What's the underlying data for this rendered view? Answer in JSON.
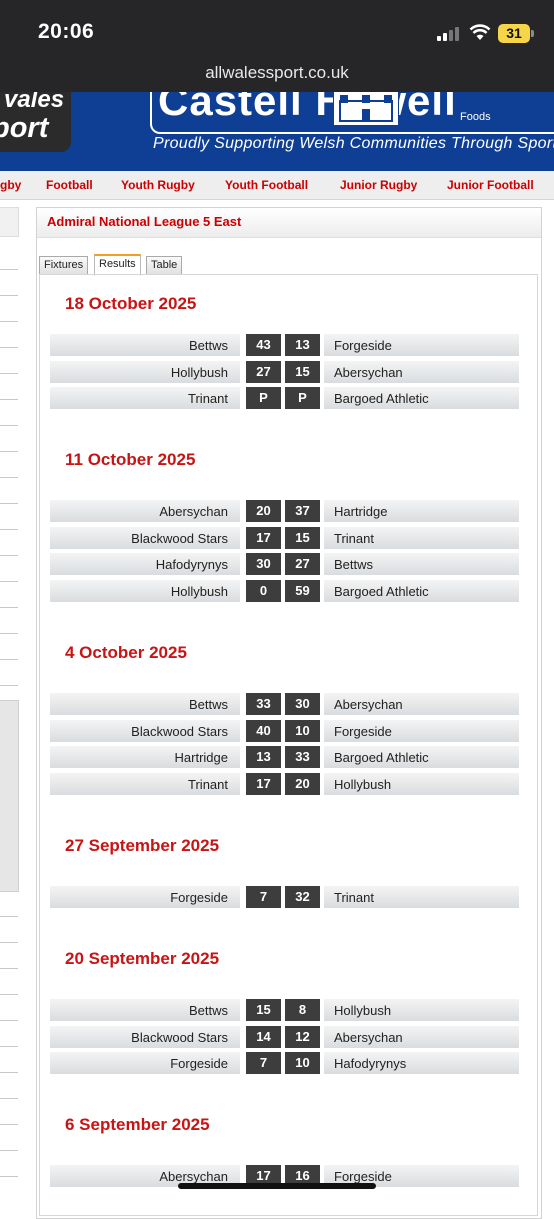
{
  "status_bar": {
    "time": "20:06",
    "battery": "31"
  },
  "browser": {
    "url": "allwalessport.co.uk"
  },
  "header": {
    "logo_line1": "vales",
    "logo_line2": "port",
    "sponsor_name": "Castell Howell",
    "sponsor_sub": "Foods",
    "sponsor_tagline": "Proudly Supporting Welsh Communities Through Sport"
  },
  "nav": {
    "items": [
      "gby",
      "Football",
      "Youth Rugby",
      "Youth Football",
      "Junior Rugby",
      "Junior Football"
    ]
  },
  "panel": {
    "title": "Admiral National League 5 East",
    "tabs": [
      "Fixtures",
      "Results",
      "Table"
    ],
    "active_tab": "Results"
  },
  "results": [
    {
      "date": "18 October 2025",
      "matches": [
        {
          "home": "Bettws",
          "home_score": "43",
          "away_score": "13",
          "away": "Forgeside"
        },
        {
          "home": "Hollybush",
          "home_score": "27",
          "away_score": "15",
          "away": "Abersychan"
        },
        {
          "home": "Trinant",
          "home_score": "P",
          "away_score": "P",
          "away": "Bargoed Athletic"
        }
      ]
    },
    {
      "date": "11 October 2025",
      "matches": [
        {
          "home": "Abersychan",
          "home_score": "20",
          "away_score": "37",
          "away": "Hartridge"
        },
        {
          "home": "Blackwood Stars",
          "home_score": "17",
          "away_score": "15",
          "away": "Trinant"
        },
        {
          "home": "Hafodyrynys",
          "home_score": "30",
          "away_score": "27",
          "away": "Bettws"
        },
        {
          "home": "Hollybush",
          "home_score": "0",
          "away_score": "59",
          "away": "Bargoed Athletic"
        }
      ]
    },
    {
      "date": "4 October 2025",
      "matches": [
        {
          "home": "Bettws",
          "home_score": "33",
          "away_score": "30",
          "away": "Abersychan"
        },
        {
          "home": "Blackwood Stars",
          "home_score": "40",
          "away_score": "10",
          "away": "Forgeside"
        },
        {
          "home": "Hartridge",
          "home_score": "13",
          "away_score": "33",
          "away": "Bargoed Athletic"
        },
        {
          "home": "Trinant",
          "home_score": "17",
          "away_score": "20",
          "away": "Hollybush"
        }
      ]
    },
    {
      "date": "27 September 2025",
      "matches": [
        {
          "home": "Forgeside",
          "home_score": "7",
          "away_score": "32",
          "away": "Trinant"
        }
      ]
    },
    {
      "date": "20 September 2025",
      "matches": [
        {
          "home": "Bettws",
          "home_score": "15",
          "away_score": "8",
          "away": "Hollybush"
        },
        {
          "home": "Blackwood Stars",
          "home_score": "14",
          "away_score": "12",
          "away": "Abersychan"
        },
        {
          "home": "Forgeside",
          "home_score": "7",
          "away_score": "10",
          "away": "Hafodyrynys"
        }
      ]
    },
    {
      "date": "6 September 2025",
      "matches": [
        {
          "home": "Abersychan",
          "home_score": "17",
          "away_score": "16",
          "away": "Forgeside"
        }
      ]
    }
  ]
}
